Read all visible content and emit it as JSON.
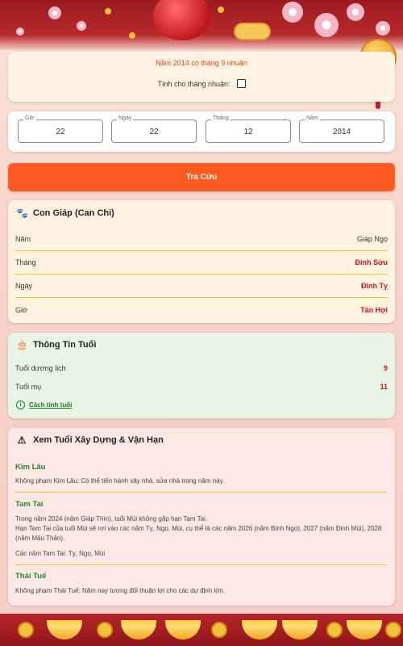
{
  "leap": {
    "status": "Năm 2014 có tháng 9 nhuận",
    "checkbox_label": "Tính cho tháng nhuận:",
    "checked": false
  },
  "date_fields": [
    {
      "label": "Giờ",
      "value": "22"
    },
    {
      "label": "Ngày",
      "value": "22"
    },
    {
      "label": "Tháng",
      "value": "12"
    },
    {
      "label": "Năm",
      "value": "2014"
    }
  ],
  "search_button": "Tra Cứu",
  "canchi": {
    "title": "Con Giáp (Can Chi)",
    "icon": "paw-icon",
    "rows": [
      {
        "key": "Năm",
        "value": "Giáp Ngọ"
      },
      {
        "key": "Tháng",
        "value": "Đinh Sửu"
      },
      {
        "key": "Ngày",
        "value": "Đinh Tỵ"
      },
      {
        "key": "Giờ",
        "value": "Tân Hợi"
      }
    ]
  },
  "age": {
    "title": "Thông Tin Tuổi",
    "icon": "cake-icon",
    "rows": [
      {
        "key": "Tuổi dương lịch",
        "value": "9"
      },
      {
        "key": "Tuổi mụ",
        "value": "11"
      }
    ],
    "how_link": "Cách tính tuổi"
  },
  "build": {
    "title": "Xem Tuổi Xây Dựng & Vận Hạn",
    "icon": "warning-icon",
    "sections": [
      {
        "title": "Kim Lâu",
        "lines": [
          "Không phạm Kim Lâu: Có thể tiến hành xây nhà, sửa nhà trong năm này."
        ]
      },
      {
        "title": "Tam Tai",
        "lines": [
          "Trong năm 2024 (năm Giáp Thìn), tuổi Mùi không gặp hạn Tam Tai.",
          "Hạn Tam Tai của tuổi Mùi sẽ rơi vào các năm Tỵ, Ngọ, Mùi, cụ thể là các năm 2026 (năm Bính Ngọ), 2027 (năm Đinh Mùi), 2028 (năm Mậu Thân).",
          "Các năm Tam Tai: Tỵ, Ngọ, Mùi"
        ]
      },
      {
        "title": "Thái Tuế",
        "lines": [
          "Không phạm Thái Tuế: Năm nay tương đối thuận lợi cho các dự định lớn."
        ]
      }
    ]
  },
  "colors": {
    "accent": "#ff5a1f",
    "value_red": "#c8161d",
    "section_green": "#1e8a2a",
    "divider_gold": "#f1c232"
  }
}
